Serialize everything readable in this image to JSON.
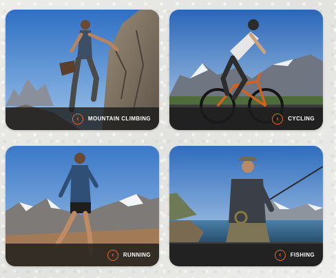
{
  "accent_color": "#e8692a",
  "cards": [
    {
      "label": "MOUNTAIN CLIMBING",
      "icon": "chevron-left-icon"
    },
    {
      "label": "CYCLING",
      "icon": "chevron-left-icon"
    },
    {
      "label": "RUNNING",
      "icon": "chevron-left-icon"
    },
    {
      "label": "FISHING",
      "icon": "chevron-left-icon"
    }
  ]
}
